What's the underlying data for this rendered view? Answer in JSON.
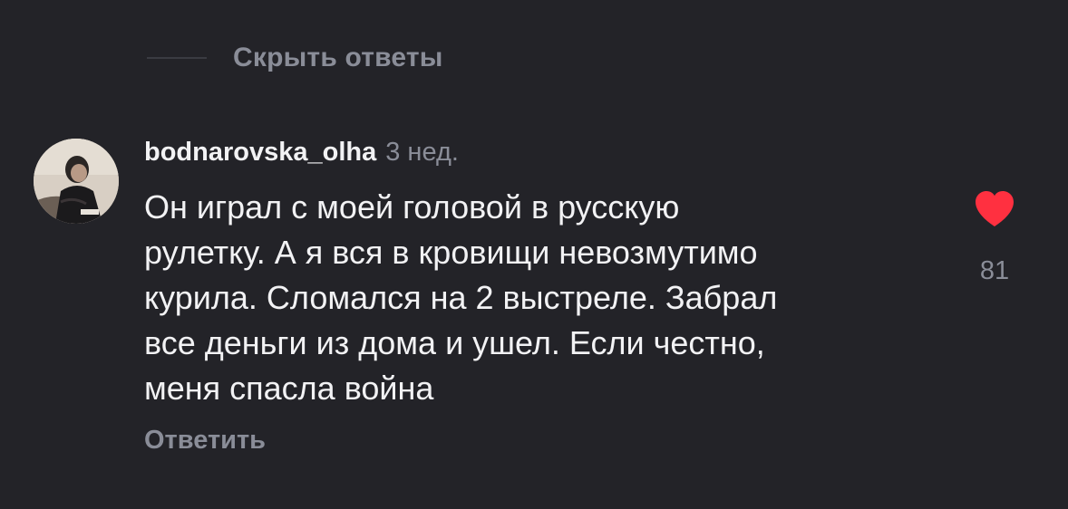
{
  "thread": {
    "hide_replies_label": "Скрыть ответы"
  },
  "comment": {
    "username": "bodnarovska_olha",
    "time": "3 нед.",
    "text": "Он играл с моей головой в русскую\nрулетку. А я вся в кровищи невозмутимо\nкурила. Сломался на 2 выстреле. Забрал\nвсе деньги из дома и ушел. Если честно,\nменя спасла война",
    "reply_label": "Ответить",
    "like_count": "81",
    "liked": true
  },
  "colors": {
    "background": "#232328",
    "text_primary": "#f2f2f4",
    "text_secondary": "#8a8d98",
    "like": "#ff3040"
  },
  "icons": {
    "like": "heart-icon",
    "avatar": "avatar"
  }
}
